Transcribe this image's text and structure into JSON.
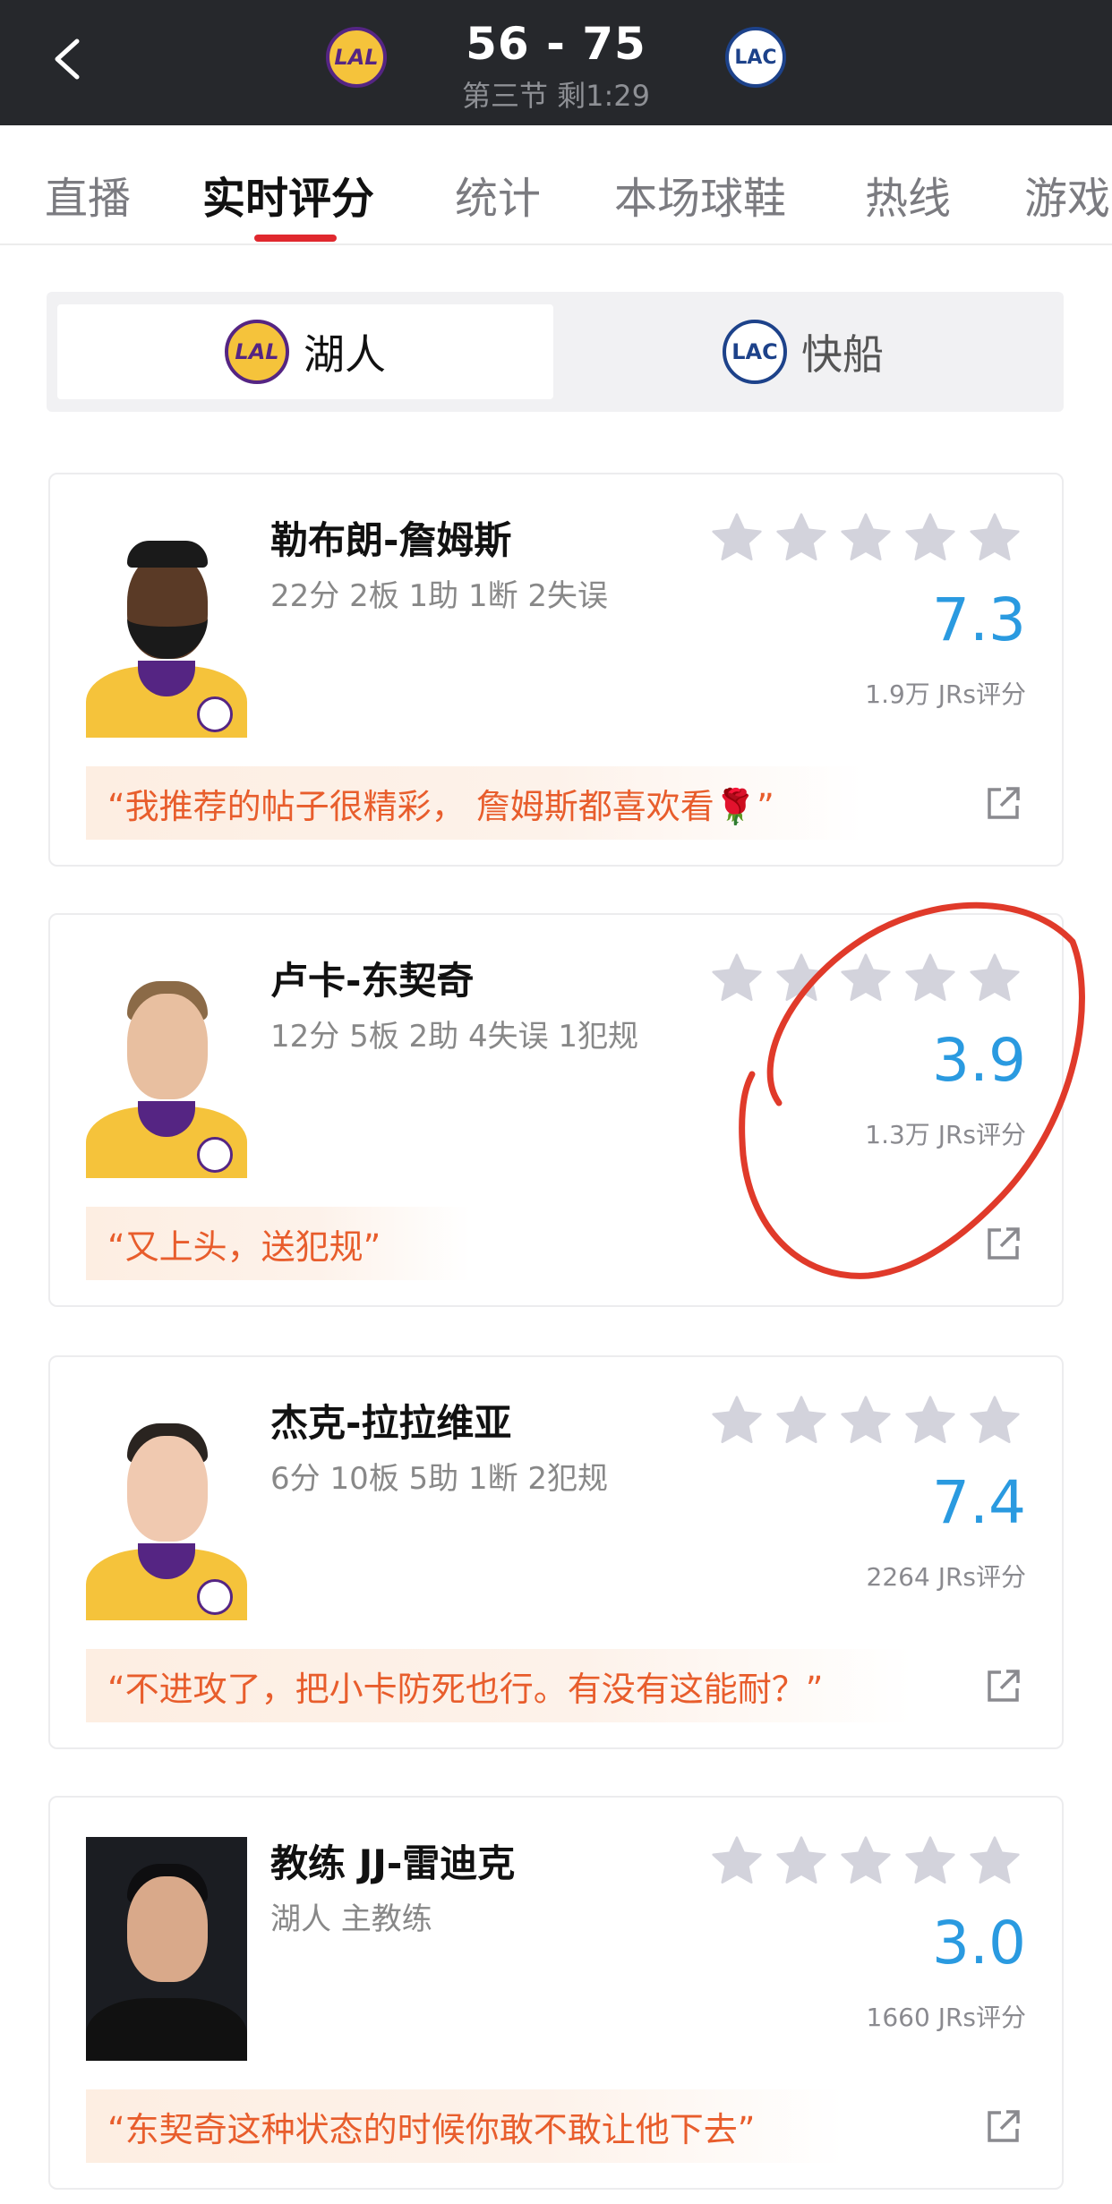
{
  "header": {
    "score": "56 - 75",
    "period": "第三节 剩1:29",
    "home_logo_text": "LAL",
    "away_logo_text": "LAC"
  },
  "tabs": [
    "直播",
    "实时评分",
    "统计",
    "本场球鞋",
    "热线",
    "游戏"
  ],
  "active_tab": "实时评分",
  "teams": [
    {
      "name": "湖人",
      "logo": "LAL",
      "selected": true
    },
    {
      "name": "快船",
      "logo": "LAC",
      "selected": false
    }
  ],
  "players": [
    {
      "name": "勒布朗-詹姆斯",
      "stats": "22分 2板 1助 1断 2失误",
      "rating": "7.3",
      "votes": "1.9万 JRs评分",
      "quote": "“我推荐的帖子很精彩， 詹姆斯都喜欢看🌹”"
    },
    {
      "name": "卢卡-东契奇",
      "stats": "12分 5板 2助 4失误 1犯规",
      "rating": "3.9",
      "votes": "1.3万 JRs评分",
      "quote": "“又上头，送犯规”"
    },
    {
      "name": "杰克-拉拉维亚",
      "stats": "6分 10板 5助 1断 2犯规",
      "rating": "7.4",
      "votes": "2264 JRs评分",
      "quote": "“不进攻了，把小卡防死也行。有没有这能耐？”"
    },
    {
      "name": "教练 JJ-雷迪克",
      "stats": "湖人 主教练",
      "rating": "3.0",
      "votes": "1660 JRs评分",
      "quote": "“东契奇这种状态的时候你敢不敢让他下去”"
    }
  ],
  "colors": {
    "header_bg": "#26282c",
    "accent_red": "#e0282e",
    "rating_blue": "#2a9ae0",
    "quote_orange": "#e85d2c",
    "star_gray": "#d3d3dc",
    "lakers_gold": "#f5c33b",
    "lakers_purple": "#552583",
    "clippers_blue": "#1d428a"
  },
  "icons": [
    "back-chevron-icon",
    "star-icon",
    "share-icon",
    "lakers-logo",
    "clippers-logo"
  ]
}
